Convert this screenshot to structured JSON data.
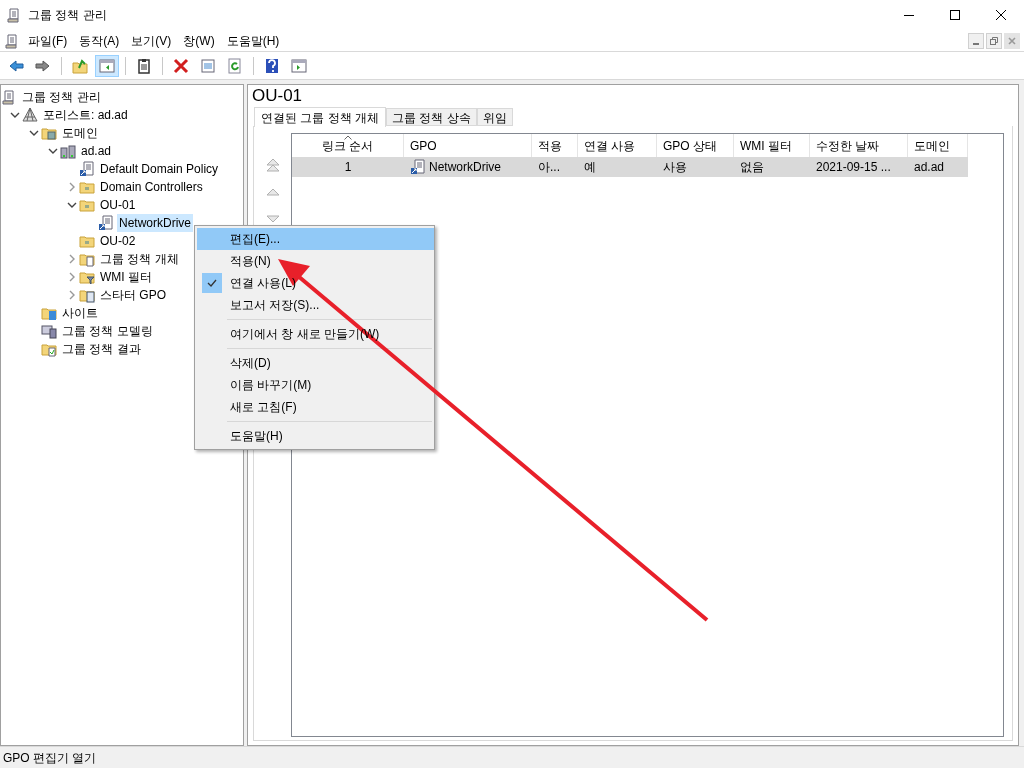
{
  "window": {
    "title": "그룹 정책 관리"
  },
  "menu_bar": [
    "파일(F)",
    "동작(A)",
    "보기(V)",
    "창(W)",
    "도움말(H)"
  ],
  "toolbar": [
    {
      "kind": "back",
      "pressed": false
    },
    {
      "kind": "forward",
      "pressed": false
    },
    {
      "kind": "sep"
    },
    {
      "kind": "up",
      "pressed": false
    },
    {
      "kind": "tree",
      "pressed": true
    },
    {
      "kind": "sep"
    },
    {
      "kind": "export",
      "pressed": false
    },
    {
      "kind": "sep"
    },
    {
      "kind": "delete",
      "pressed": false
    },
    {
      "kind": "properties",
      "pressed": false
    },
    {
      "kind": "refresh",
      "pressed": false
    },
    {
      "kind": "sep"
    },
    {
      "kind": "help",
      "pressed": false
    },
    {
      "kind": "pane",
      "pressed": false
    }
  ],
  "tree": [
    {
      "label": "그룹 정책 관리",
      "kind": "scroll",
      "selected": false,
      "children": [
        {
          "label": "포리스트: ad.ad",
          "kind": "forest",
          "expanded": true,
          "selected": false,
          "children": [
            {
              "label": "도메인",
              "kind": "domains",
              "expanded": true,
              "selected": false,
              "children": [
                {
                  "label": "ad.ad",
                  "kind": "domain",
                  "expanded": true,
                  "selected": false,
                  "children": [
                    {
                      "label": "Default Domain Policy",
                      "kind": "gpo",
                      "selected": false
                    },
                    {
                      "label": "Domain Controllers",
                      "kind": "ou",
                      "expanded": false,
                      "selected": false
                    },
                    {
                      "label": "OU-01",
                      "kind": "ou",
                      "expanded": true,
                      "selected": false,
                      "children": [
                        {
                          "label": "NetworkDrive",
                          "kind": "gpo",
                          "selected": true
                        }
                      ]
                    },
                    {
                      "label": "OU-02",
                      "kind": "ou",
                      "selected": false
                    },
                    {
                      "label": "그룹 정책 개체",
                      "kind": "gpofolder",
                      "expanded": false,
                      "selected": false
                    },
                    {
                      "label": "WMI 필터",
                      "kind": "wmi",
                      "expanded": false,
                      "selected": false
                    },
                    {
                      "label": "스타터 GPO",
                      "kind": "starter",
                      "expanded": false,
                      "selected": false
                    }
                  ]
                }
              ]
            },
            {
              "label": "사이트",
              "kind": "sites",
              "selected": false
            },
            {
              "label": "그룹 정책 모델링",
              "kind": "modeling",
              "selected": false
            },
            {
              "label": "그룹 정책 결과",
              "kind": "results",
              "selected": false
            }
          ]
        }
      ]
    }
  ],
  "details": {
    "title": "OU-01",
    "tabs": [
      {
        "label": "연결된 그룹 정책 개체",
        "selected": true
      },
      {
        "label": "그룹 정책 상속",
        "selected": false
      },
      {
        "label": "위임",
        "selected": false
      }
    ],
    "columns": [
      {
        "label": "링크 순서",
        "sorted": true
      },
      {
        "label": "GPO",
        "sorted": false
      },
      {
        "label": "적용",
        "sorted": false
      },
      {
        "label": "연결 사용",
        "sorted": false
      },
      {
        "label": "GPO 상태",
        "sorted": false
      },
      {
        "label": "WMI 필터",
        "sorted": false
      },
      {
        "label": "수정한 날짜",
        "sorted": false
      },
      {
        "label": "도메인",
        "sorted": false
      }
    ],
    "rows": [
      {
        "selected": true,
        "cells": [
          "1",
          "NetworkDrive",
          "아...",
          "예",
          "사용",
          "없음",
          "2021-09-15 ...",
          "ad.ad"
        ]
      }
    ]
  },
  "context_menu": [
    {
      "kind": "item",
      "label": "편집(E)...",
      "highlighted": true,
      "checked": false
    },
    {
      "kind": "item",
      "label": "적용(N)",
      "highlighted": false,
      "checked": false
    },
    {
      "kind": "item",
      "label": "연결 사용(L)",
      "highlighted": false,
      "checked": true
    },
    {
      "kind": "item",
      "label": "보고서 저장(S)...",
      "highlighted": false,
      "checked": false
    },
    {
      "kind": "separator"
    },
    {
      "kind": "item",
      "label": "여기에서 창 새로 만들기(W)",
      "highlighted": false,
      "checked": false
    },
    {
      "kind": "separator"
    },
    {
      "kind": "item",
      "label": "삭제(D)",
      "highlighted": false,
      "checked": false
    },
    {
      "kind": "item",
      "label": "이름 바꾸기(M)",
      "highlighted": false,
      "checked": false
    },
    {
      "kind": "item",
      "label": "새로 고침(F)",
      "highlighted": false,
      "checked": false
    },
    {
      "kind": "separator"
    },
    {
      "kind": "item",
      "label": "도움말(H)",
      "highlighted": false,
      "checked": false
    }
  ],
  "status_bar": "GPO 편집기 열기"
}
